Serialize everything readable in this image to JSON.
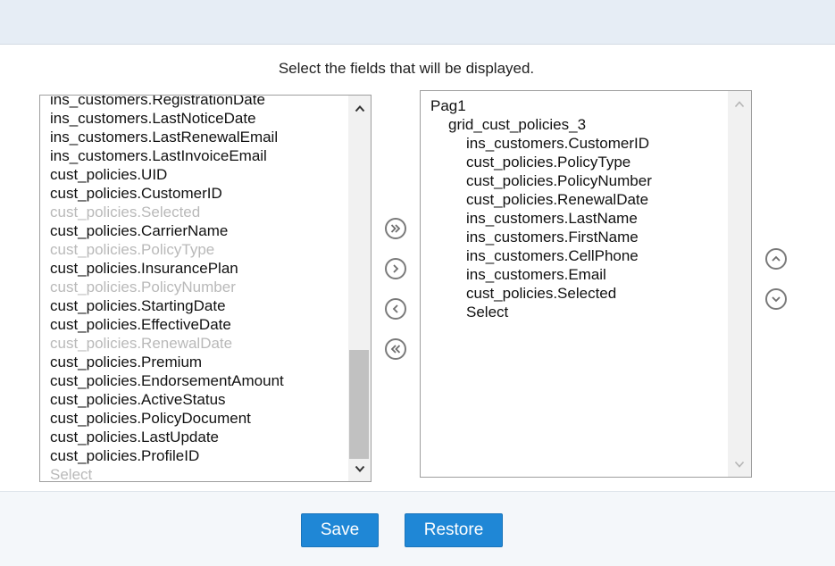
{
  "instruction": "Select the fields that will be displayed.",
  "available_fields": [
    {
      "label": "ins_customers.RegistrationDate",
      "disabled": false
    },
    {
      "label": "ins_customers.LastNoticeDate",
      "disabled": false
    },
    {
      "label": "ins_customers.LastRenewalEmail",
      "disabled": false
    },
    {
      "label": "ins_customers.LastInvoiceEmail",
      "disabled": false
    },
    {
      "label": "cust_policies.UID",
      "disabled": false
    },
    {
      "label": "cust_policies.CustomerID",
      "disabled": false
    },
    {
      "label": "cust_policies.Selected",
      "disabled": true
    },
    {
      "label": "cust_policies.CarrierName",
      "disabled": false
    },
    {
      "label": "cust_policies.PolicyType",
      "disabled": true
    },
    {
      "label": "cust_policies.InsurancePlan",
      "disabled": false
    },
    {
      "label": "cust_policies.PolicyNumber",
      "disabled": true
    },
    {
      "label": "cust_policies.StartingDate",
      "disabled": false
    },
    {
      "label": "cust_policies.EffectiveDate",
      "disabled": false
    },
    {
      "label": "cust_policies.RenewalDate",
      "disabled": true
    },
    {
      "label": "cust_policies.Premium",
      "disabled": false
    },
    {
      "label": "cust_policies.EndorsementAmount",
      "disabled": false
    },
    {
      "label": "cust_policies.ActiveStatus",
      "disabled": false
    },
    {
      "label": "cust_policies.PolicyDocument",
      "disabled": false
    },
    {
      "label": "cust_policies.LastUpdate",
      "disabled": false
    },
    {
      "label": "cust_policies.ProfileID",
      "disabled": false
    },
    {
      "label": "Select",
      "disabled": true
    }
  ],
  "selected_fields": [
    {
      "label": "Pag1",
      "level": 0
    },
    {
      "label": "grid_cust_policies_3",
      "level": 1
    },
    {
      "label": "ins_customers.CustomerID",
      "level": 2
    },
    {
      "label": "cust_policies.PolicyType",
      "level": 2
    },
    {
      "label": "cust_policies.PolicyNumber",
      "level": 2
    },
    {
      "label": "cust_policies.RenewalDate",
      "level": 2
    },
    {
      "label": "ins_customers.LastName",
      "level": 2
    },
    {
      "label": "ins_customers.FirstName",
      "level": 2
    },
    {
      "label": "ins_customers.CellPhone",
      "level": 2
    },
    {
      "label": "ins_customers.Email",
      "level": 2
    },
    {
      "label": "cust_policies.Selected",
      "level": 2
    },
    {
      "label": "Select",
      "level": 2
    }
  ],
  "available_scroll_position": 0.66,
  "icons": {
    "move_all_right": "double-chevron-right-icon",
    "move_right": "chevron-right-icon",
    "move_left": "chevron-left-icon",
    "move_all_left": "double-chevron-left-icon",
    "move_up": "chevron-up-icon",
    "move_down": "chevron-down-icon"
  },
  "colors": {
    "button_blue": "#1f87d6",
    "header_bg": "#e6edf5",
    "disabled_text": "#b9b9b9"
  },
  "buttons": {
    "save": "Save",
    "restore": "Restore"
  }
}
